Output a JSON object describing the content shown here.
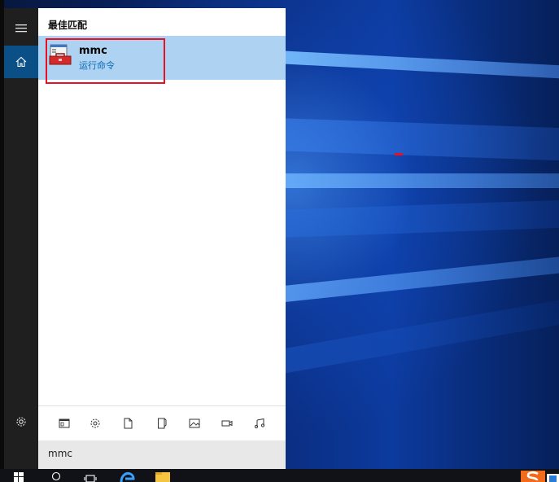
{
  "search_panel": {
    "section_title": "最佳匹配",
    "best_match": {
      "title": "mmc",
      "subtitle": "运行命令",
      "icon": "toolbox-icon"
    },
    "query": "mmc"
  },
  "rail": {
    "items": [
      {
        "icon": "hamburger-menu-icon"
      },
      {
        "icon": "home-icon"
      },
      {
        "icon": "gear-icon"
      }
    ]
  },
  "filters": [
    {
      "icon": "apps-icon"
    },
    {
      "icon": "settings-icon"
    },
    {
      "icon": "document-icon"
    },
    {
      "icon": "folder-icon"
    },
    {
      "icon": "photos-icon"
    },
    {
      "icon": "videos-icon"
    },
    {
      "icon": "music-icon"
    }
  ],
  "taskbar": {
    "items": [
      "windows-start-icon",
      "search-icon",
      "task-view-icon",
      "edge-icon",
      "file-explorer-icon",
      "sogou-ime-icon"
    ]
  },
  "colors": {
    "accent": "#0b4f87",
    "highlight": "#aed2f2",
    "annotation_red": "#e81123"
  }
}
